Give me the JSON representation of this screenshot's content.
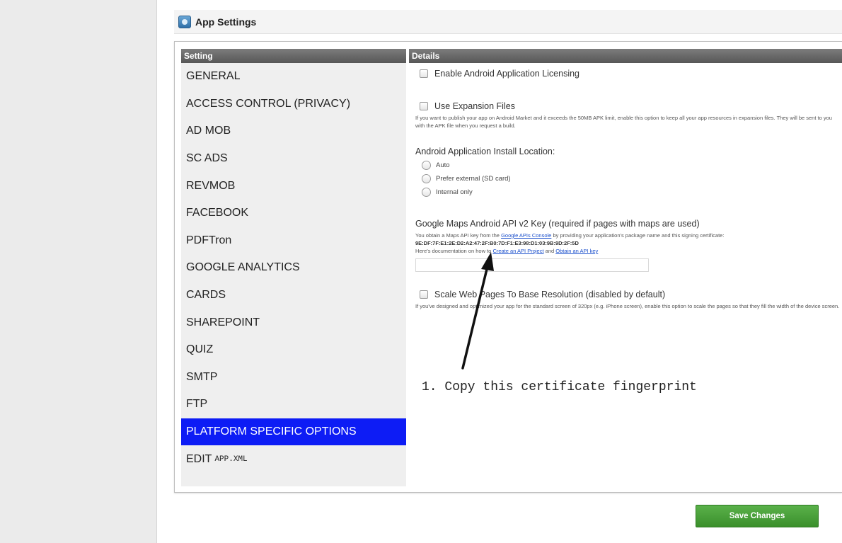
{
  "header": {
    "title": "App Settings",
    "icon": "app-settings-icon"
  },
  "columns": {
    "setting": "Setting",
    "details": "Details"
  },
  "sidebar": {
    "items": [
      {
        "label": "GENERAL"
      },
      {
        "label": "ACCESS CONTROL (PRIVACY)"
      },
      {
        "label": "AD MOB"
      },
      {
        "label": "SC ADS"
      },
      {
        "label": "REVMOB"
      },
      {
        "label": "FACEBOOK"
      },
      {
        "label": "PDFTron"
      },
      {
        "label": "GOOGLE ANALYTICS"
      },
      {
        "label": "CARDS"
      },
      {
        "label": "SHAREPOINT"
      },
      {
        "label": "QUIZ"
      },
      {
        "label": "SMTP"
      },
      {
        "label": "FTP"
      },
      {
        "label": "PLATFORM SPECIFIC OPTIONS"
      }
    ],
    "edit_label": "EDIT",
    "edit_file": "APP.XML",
    "active_color": "#0d1cf5"
  },
  "details": {
    "licensing_label": "Enable Android Application Licensing",
    "expansion_label": "Use Expansion Files",
    "expansion_help": "If you want to publish your app on Android Market and it exceeds the 50MB APK limit, enable this option to keep all your app resources in expansion files. They will be sent to you with the APK file when you request a build.",
    "install_location_label": "Android Application Install Location:",
    "install_options": [
      "Auto",
      "Prefer external (SD card)",
      "Internal only"
    ],
    "maps_label": "Google Maps Android API v2 Key (required if pages with maps are used)",
    "maps_help_1": "You obtain a Maps API key from the",
    "maps_help_link": "Google APIs Console",
    "maps_help_2": "by providing your application's package name and this signing certificate:",
    "fingerprint": "9E:DF:7F:E1:2E:D2:A2:47:2F:B0:7D:F1:E3:98:D1:03:9B:9D:2F:5D",
    "doc_text_1": "Here's documentation on how to",
    "doc_link_1": "Create an API Project",
    "doc_and": "and",
    "doc_link_2": "Obtain an API key",
    "api_key_value": "",
    "scale_label": "Scale Web Pages To Base Resolution (disabled by default)",
    "scale_help": "If you've designed and optimized your app for the standard screen of 320px (e.g. iPhone screen), enable this option to scale the pages so that they fill the width of the device screen."
  },
  "annotation": {
    "text": "1. Copy this certificate fingerprint"
  },
  "footer": {
    "save_label": "Save Changes",
    "save_color": "#4ca33c"
  }
}
